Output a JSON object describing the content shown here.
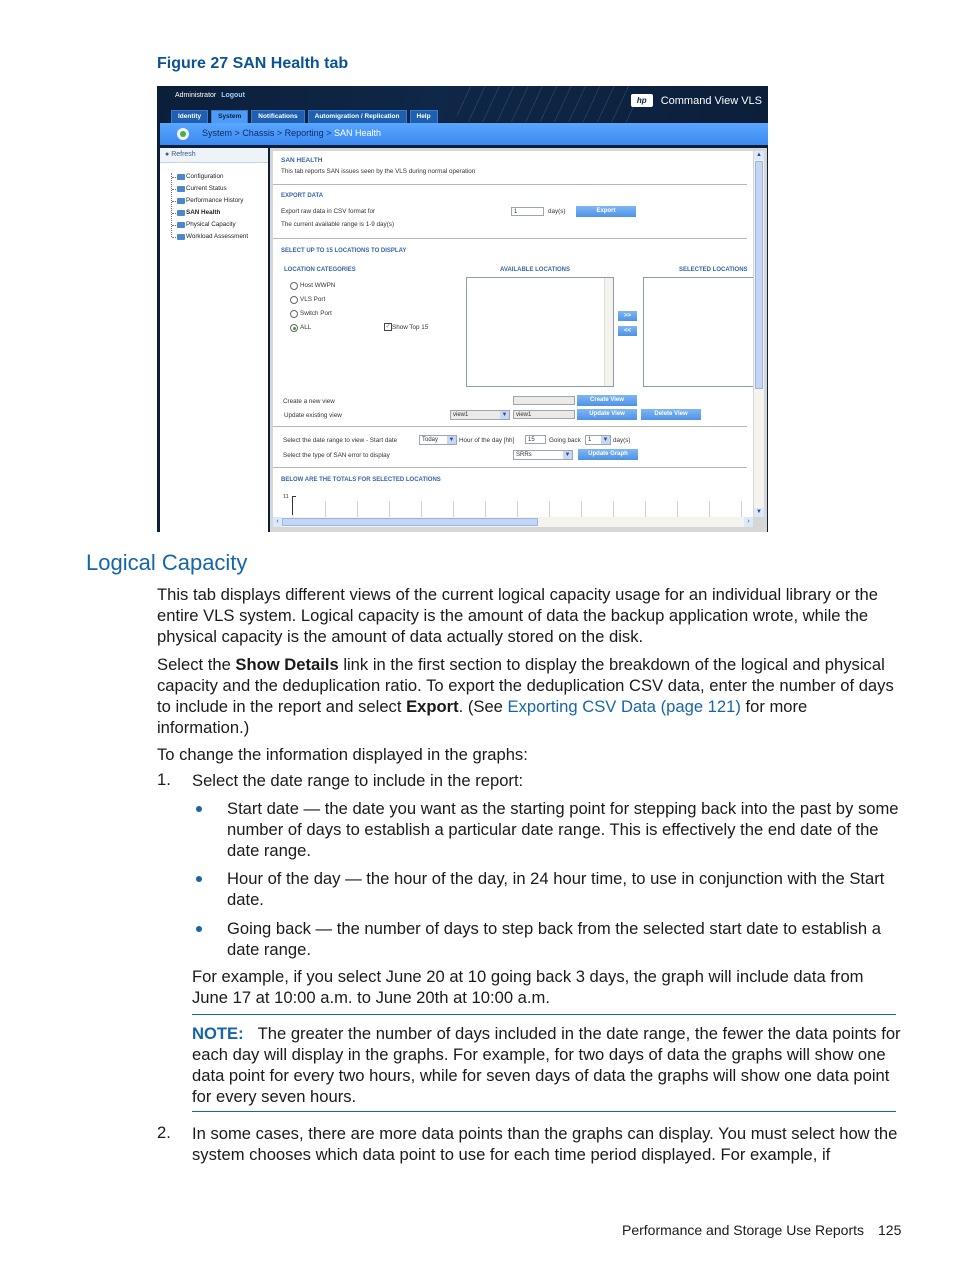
{
  "figure": {
    "caption": "Figure 27 SAN Health tab",
    "app": {
      "user": "Administrator",
      "logout": "Logout",
      "brand_logo": "hp",
      "brand_title": "Command View VLS",
      "tabs": [
        {
          "label": "Identity",
          "active": false
        },
        {
          "label": "System",
          "active": true
        },
        {
          "label": "Notifications",
          "active": false
        },
        {
          "label": "Automigration / Replication",
          "active": false
        },
        {
          "label": "Help",
          "active": false
        }
      ],
      "breadcrumb": {
        "items": [
          "System",
          "Chassis",
          "Reporting"
        ],
        "separator": ">",
        "current": "SAN Health"
      },
      "sidebar": {
        "refresh": "Refresh",
        "items": [
          {
            "label": "Configuration"
          },
          {
            "label": "Current Status"
          },
          {
            "label": "Performance History"
          },
          {
            "label": "SAN Health",
            "selected": true
          },
          {
            "label": "Physical Capacity"
          },
          {
            "label": "Workload Assessment"
          }
        ]
      },
      "main": {
        "title": "SAN HEALTH",
        "description": "This tab reports SAN issues seen by the VLS during normal operation",
        "export": {
          "title": "EXPORT DATA",
          "label": "Export raw data in CSV format for",
          "days_value": "1",
          "days_unit": "day(s)",
          "button": "Export",
          "range_note": "The current available range is 1-9 day(s)"
        },
        "locations": {
          "title": "SELECT UP TO 15 LOCATIONS TO DISPLAY",
          "categories_header": "LOCATION CATEGORIES",
          "available_header": "AVAILABLE LOCATIONS",
          "selected_header": "SELECTED LOCATIONS",
          "categories": [
            {
              "label": "Host WWPN",
              "checked": false
            },
            {
              "label": "VLS Port",
              "checked": false
            },
            {
              "label": "Switch Port",
              "checked": false
            },
            {
              "label": "ALL",
              "checked": true
            }
          ],
          "show_top": {
            "label": "Show Top 15",
            "checked": true
          },
          "add_button": ">>",
          "remove_button": "<<"
        },
        "views": {
          "create_label": "Create a new view",
          "create_value": "",
          "create_button": "Create View",
          "update_label": "Update existing view",
          "update_select": "view1",
          "update_value": "view1",
          "update_button": "Update View",
          "delete_button": "Delete View"
        },
        "range": {
          "date_label": "Select the date range to view - Start date",
          "start_date": "Today",
          "hour_label": "Hour of the day [hh]",
          "hour_value": "15",
          "going_back_label": "Going back",
          "going_back_value": "1",
          "going_back_unit": "day(s)",
          "error_type_label": "Select the type of SAN error to display",
          "error_type_value": "SRRs",
          "update_graph_button": "Update Graph"
        },
        "totals": {
          "title": "BELOW ARE THE TOTALS FOR SELECTED LOCATIONS",
          "axis_top": "11"
        }
      }
    }
  },
  "document": {
    "heading": "Logical Capacity",
    "para1": "This tab displays different views of the current logical capacity usage for an individual library or the entire VLS system. Logical capacity is the amount of data the backup application wrote, while the physical capacity is the amount of data actually stored on the disk.",
    "para2": {
      "pre": "Select the ",
      "bold1": "Show Details",
      "mid": " link in the first section to display the breakdown of the logical and physical capacity and the deduplication ratio. To export the deduplication CSV data, enter the number of days to include in the report and select ",
      "bold2": "Export",
      "mid2": ". (See ",
      "link": "Exporting CSV Data (page 121)",
      "post": " for more information.)"
    },
    "para3": "To change the information displayed in the graphs:",
    "steps": [
      {
        "num": "1.",
        "text": "Select the date range to include in the report:"
      },
      {
        "num": "2.",
        "text": "In some cases, there are more data points than the graphs can display. You must select how the system chooses which data point to use for each time period displayed. For example, if"
      }
    ],
    "bullets": [
      "Start date — the date you want as the starting point for stepping back into the past by some number of days to establish a particular date range. This is effectively the end date of the date range.",
      "Hour of the day — the hour of the day, in 24 hour time, to use in conjunction with the Start date.",
      "Going back — the number of days to step back from the selected start date to establish a date range."
    ],
    "example": "For example, if you select June 20 at 10 going back 3 days, the graph will include data from June 17 at 10:00 a.m. to June 20th at 10:00 a.m.",
    "note": {
      "label": "NOTE:",
      "text": "The greater the number of days included in the date range, the fewer the data points for each day will display in the graphs. For example, for two days of data the graphs will show one data point for every two hours, while for seven days of data the graphs will show one data point for every seven hours."
    }
  },
  "footer": {
    "section": "Performance and Storage Use Reports",
    "page": "125"
  }
}
